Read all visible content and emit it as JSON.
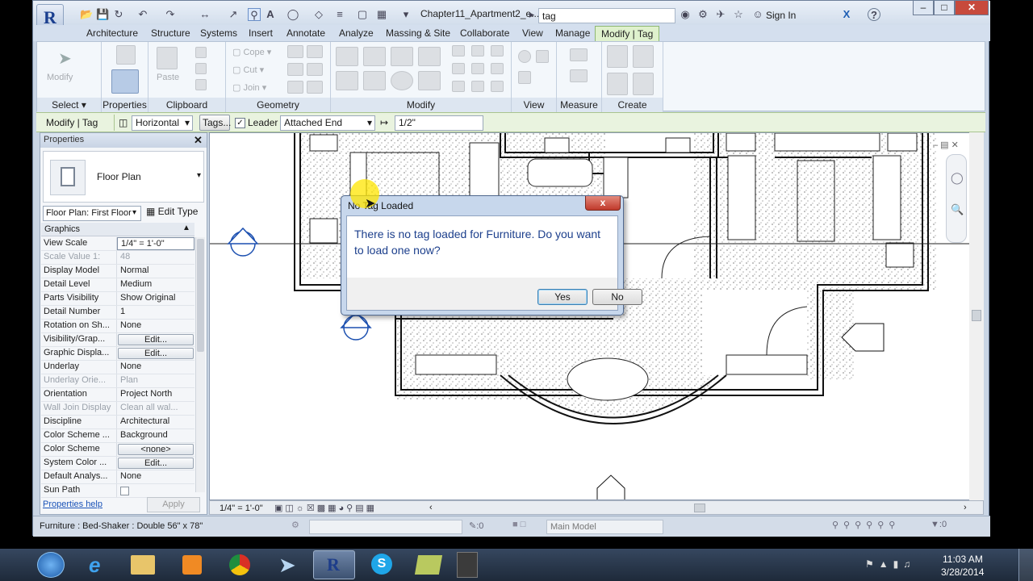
{
  "window": {
    "doc_title": "Chapter11_Apartment2_e...",
    "search_value": "tag",
    "sign_in": "Sign In",
    "help": "?"
  },
  "tabs": [
    "Architecture",
    "Structure",
    "Systems",
    "Insert",
    "Annotate",
    "Analyze",
    "Massing & Site",
    "Collaborate",
    "View",
    "Manage",
    "Modify | Tag"
  ],
  "ribbon": {
    "panels": [
      "Select",
      "Properties",
      "Clipboard",
      "Geometry",
      "Modify",
      "View",
      "Measure",
      "Create"
    ],
    "modify_label": "Modify",
    "paste_label": "Paste",
    "cope_label": "Cope",
    "cut_label": "Cut",
    "join_label": "Join"
  },
  "options_bar": {
    "context": "Modify | Tag",
    "orientation": "Horizontal",
    "tags_button": "Tags...",
    "leader_label": "Leader",
    "leader_checked": true,
    "attach": "Attached End",
    "length": "1/2\""
  },
  "properties": {
    "header": "Properties",
    "type_name": "Floor Plan",
    "instance_selector": "Floor Plan: First Floor",
    "edit_type": "Edit Type",
    "section": "Graphics",
    "rows": [
      {
        "name": "View Scale",
        "value": "1/4\" = 1'-0\"",
        "style": "input"
      },
      {
        "name": "Scale Value    1:",
        "value": "48",
        "style": "grey"
      },
      {
        "name": "Display Model",
        "value": "Normal",
        "style": ""
      },
      {
        "name": "Detail Level",
        "value": "Medium",
        "style": ""
      },
      {
        "name": "Parts Visibility",
        "value": "Show Original",
        "style": ""
      },
      {
        "name": "Detail Number",
        "value": "1",
        "style": ""
      },
      {
        "name": "Rotation on Sh...",
        "value": "None",
        "style": ""
      },
      {
        "name": "Visibility/Grap...",
        "value": "Edit...",
        "style": "btn"
      },
      {
        "name": "Graphic Displa...",
        "value": "Edit...",
        "style": "btn"
      },
      {
        "name": "Underlay",
        "value": "None",
        "style": ""
      },
      {
        "name": "Underlay Orie...",
        "value": "Plan",
        "style": "grey"
      },
      {
        "name": "Orientation",
        "value": "Project North",
        "style": ""
      },
      {
        "name": "Wall Join Display",
        "value": "Clean all wal...",
        "style": "grey"
      },
      {
        "name": "Discipline",
        "value": "Architectural",
        "style": ""
      },
      {
        "name": "Color Scheme ...",
        "value": "Background",
        "style": ""
      },
      {
        "name": "Color Scheme",
        "value": "<none>",
        "style": "btn"
      },
      {
        "name": "System Color ...",
        "value": "Edit...",
        "style": "btn"
      },
      {
        "name": "Default Analys...",
        "value": "None",
        "style": ""
      },
      {
        "name": "Sun Path",
        "value": "",
        "style": "check"
      }
    ],
    "help_link": "Properties help",
    "apply": "Apply"
  },
  "view_bar": {
    "scale": "1/4\" = 1'-0\""
  },
  "status_bar": {
    "message": "Furniture : Bed-Shaker : Double 56\" x 78\"",
    "count": ":0",
    "model": "Main Model"
  },
  "dialog": {
    "title": "No Tag Loaded",
    "message": "There is no tag loaded for Furniture. Do you want to load one now?",
    "yes": "Yes",
    "no": "No",
    "close": "x"
  },
  "taskbar": {
    "time": "11:03 AM",
    "date": "3/28/2014"
  }
}
